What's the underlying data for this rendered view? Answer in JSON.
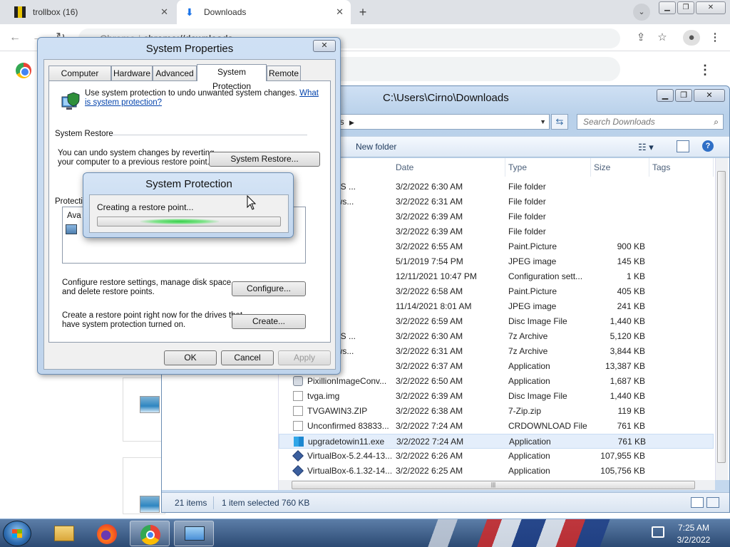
{
  "chrome": {
    "tabs": [
      {
        "title": "trollbox (16)"
      },
      {
        "title": "Downloads"
      }
    ],
    "omnibox": {
      "scheme": "Chrome",
      "url": "chrome://downloads"
    }
  },
  "explorer": {
    "title": "C:\\Users\\Cirno\\Downloads",
    "address_tail": "ds",
    "search_placeholder": "Search Downloads",
    "new_folder": "New folder",
    "columns": {
      "date": "Date",
      "type": "Type",
      "size": "Size",
      "tags": "Tags"
    },
    "rows": [
      {
        "name": "t MS-DOS ...",
        "date": "3/2/2022 6:30 AM",
        "type": "File folder",
        "size": "",
        "icon": "folder"
      },
      {
        "name": "t Windows...",
        "date": "3/2/2022 6:31 AM",
        "type": "File folder",
        "size": "",
        "icon": "folder"
      },
      {
        "name": "N3",
        "date": "3/2/2022 6:39 AM",
        "type": "File folder",
        "size": "",
        "icon": "folder"
      },
      {
        "name": "00",
        "date": "3/2/2022 6:39 AM",
        "type": "File folder",
        "size": "",
        "icon": "folder"
      },
      {
        "name": "mp",
        "date": "3/2/2022 6:55 AM",
        "type": "Paint.Picture",
        "size": "900 KB",
        "icon": "image"
      },
      {
        "name": "pg",
        "date": "5/1/2019 7:54 PM",
        "type": "JPEG image",
        "size": "145 KB",
        "icon": "image"
      },
      {
        "name": "ni",
        "date": "12/11/2021 10:47 PM",
        "type": "Configuration sett...",
        "size": "1 KB",
        "icon": "doc"
      },
      {
        "name": "mp",
        "date": "3/2/2022 6:58 AM",
        "type": "Paint.Picture",
        "size": "405 KB",
        "icon": "image"
      },
      {
        "name": "pg",
        "date": "11/14/2021 8:01 AM",
        "type": "JPEG image",
        "size": "241 KB",
        "icon": "image"
      },
      {
        "name": "mg",
        "date": "3/2/2022 6:59 AM",
        "type": "Disc Image File",
        "size": "1,440 KB",
        "icon": "doc"
      },
      {
        "name": "t MS-DOS ...",
        "date": "3/2/2022 6:30 AM",
        "type": "7z Archive",
        "size": "5,120 KB",
        "icon": "archive"
      },
      {
        "name": "t Windows...",
        "date": "3/2/2022 6:31 AM",
        "type": "7z Archive",
        "size": "3,844 KB",
        "icon": "archive"
      },
      {
        "name": "tup.exe",
        "date": "3/2/2022 6:37 AM",
        "type": "Application",
        "size": "13,387 KB",
        "icon": "app"
      },
      {
        "name": "PixillionImageConv...",
        "date": "3/2/2022 6:50 AM",
        "type": "Application",
        "size": "1,687 KB",
        "icon": "app"
      },
      {
        "name": "tvga.img",
        "date": "3/2/2022 6:39 AM",
        "type": "Disc Image File",
        "size": "1,440 KB",
        "icon": "doc"
      },
      {
        "name": "TVGAWIN3.ZIP",
        "date": "3/2/2022 6:38 AM",
        "type": "7-Zip.zip",
        "size": "119 KB",
        "icon": "doc"
      },
      {
        "name": "Unconfirmed 83833...",
        "date": "3/2/2022 7:24 AM",
        "type": "CRDOWNLOAD File",
        "size": "761 KB",
        "icon": "doc"
      },
      {
        "name": "upgradetowin11.exe",
        "date": "3/2/2022 7:24 AM",
        "type": "Application",
        "size": "761 KB",
        "icon": "win",
        "selected": true
      },
      {
        "name": "VirtualBox-5.2.44-13...",
        "date": "3/2/2022 6:26 AM",
        "type": "Application",
        "size": "107,955 KB",
        "icon": "vbox"
      },
      {
        "name": "VirtualBox-6.1.32-14...",
        "date": "3/2/2022 6:25 AM",
        "type": "Application",
        "size": "105,756 KB",
        "icon": "vbox"
      }
    ],
    "status": {
      "items": "21 items",
      "selected": "1 item selected 760 KB"
    }
  },
  "sysprop": {
    "title": "System Properties",
    "tabs": [
      "Computer Name",
      "Hardware",
      "Advanced",
      "System Protection",
      "Remote"
    ],
    "intro": "Use system protection to undo unwanted system changes.",
    "link_a": "What",
    "link_b": "is system protection?",
    "restore_heading": "System Restore",
    "restore_text_1": "You can undo system changes by reverting",
    "restore_text_2": "your computer to a previous restore point.",
    "restore_button": "System Restore...",
    "protection_label": "Protecti",
    "list_header": "Ava",
    "configure_text_1": "Configure restore settings, manage disk space,",
    "configure_text_2": "and delete restore points.",
    "configure_button": "Configure...",
    "create_text_1": "Create a restore point right now for the drives that",
    "create_text_2": "have system protection turned on.",
    "create_button": "Create...",
    "ok": "OK",
    "cancel": "Cancel",
    "apply": "Apply"
  },
  "progress": {
    "title": "System Protection",
    "message": "Creating a restore point..."
  },
  "taskbar": {
    "time": "7:25 AM",
    "date": "3/2/2022"
  }
}
